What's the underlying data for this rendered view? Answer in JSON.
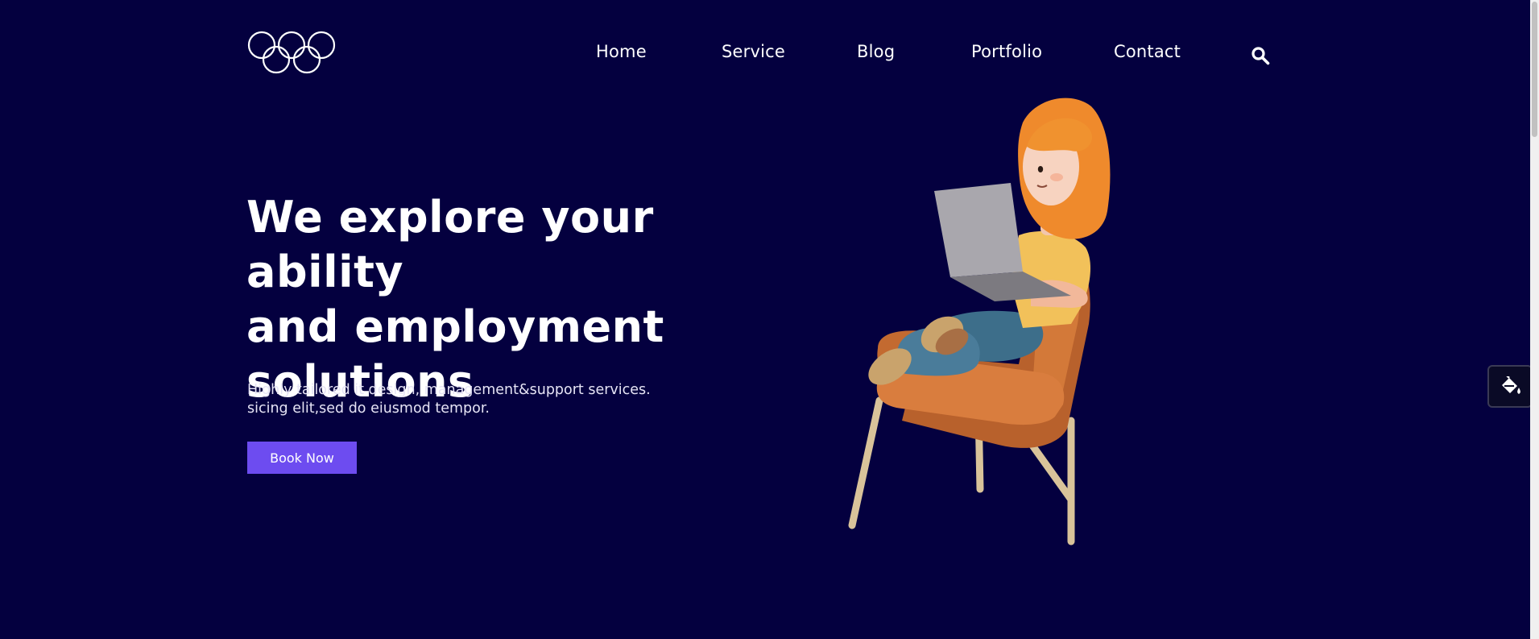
{
  "nav": {
    "items": [
      {
        "label": "Home"
      },
      {
        "label": "Service"
      },
      {
        "label": "Blog"
      },
      {
        "label": "Portfolio"
      },
      {
        "label": "Contact"
      }
    ],
    "search_icon": "search-icon"
  },
  "hero": {
    "title_line1": "We explore your ability",
    "title_line2": "and employment",
    "title_line3": "solutions",
    "desc_line1": "Highly tailored it design, management&support services.",
    "desc_line2": "sicing elit,sed do eiusmod tempor.",
    "cta_label": "Book Now"
  },
  "colors": {
    "background": "#04003f",
    "accent": "#6d4cf0",
    "text": "#ffffff"
  },
  "side_tool": {
    "icon": "paint-bucket-icon"
  }
}
